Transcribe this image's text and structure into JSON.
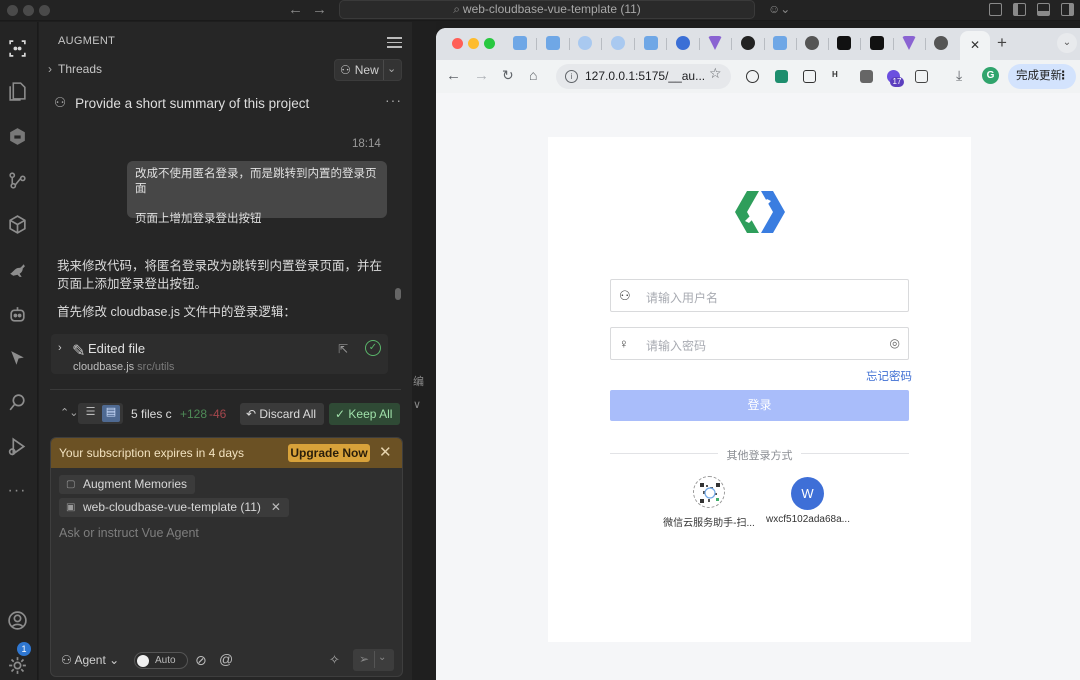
{
  "window": {
    "title": "web-cloudbase-vue-template (11)",
    "back_icon": "arrow-left-icon",
    "forward_icon": "arrow-right-icon",
    "copilot_icon": "copilot-icon"
  },
  "activity_bar": {
    "items": [
      "augment-icon",
      "files-icon",
      "extension-icon",
      "git-icon",
      "package-icon",
      "kangaroo-icon",
      "robot-icon",
      "cursor-icon",
      "search-icon",
      "run-debug-icon",
      "more-icon"
    ],
    "account_badge": "1"
  },
  "augment": {
    "header": "AUGMENT",
    "threads_label": "Threads",
    "new_label": "New",
    "thread_title": "Provide a short summary of this project",
    "more_label": "···",
    "timestamp": "18:14",
    "user_message_lines": [
      "改成不使用匿名登录，而是跳转到内置的登录页面",
      "页面上增加登录登出按钮"
    ],
    "assistant_reply": "我来修改代码，将匿名登录改为跳转到内置登录页面，并在页面上添加登录登出按钮。",
    "assistant_reply2": "首先修改 cloudbase.js 文件中的登录逻辑：",
    "edited_file": {
      "label": "Edited file",
      "filename": "cloudbase.js",
      "path": "src/utils"
    },
    "changes": {
      "files": "5 files c",
      "added": "+128",
      "removed": "-46",
      "discard_label": "Discard All",
      "keep_label": "Keep All"
    },
    "subscription": {
      "text": "Your subscription expires in 4 days",
      "upgrade_label": "Upgrade Now"
    },
    "chips": [
      "Augment Memories",
      "web-cloudbase-vue-template (11)"
    ],
    "placeholder": "Ask or instruct Vue Agent",
    "mode_label": "Agent",
    "auto_label": "Auto"
  },
  "gap_fragments": [
    "编",
    "∨"
  ],
  "browser": {
    "active_tab_close": "✕",
    "address": "127.0.0.1:5175/__au...",
    "update_label": "完成更新",
    "ext_badge": "17",
    "profile_initial": "G"
  },
  "login": {
    "username_placeholder": "请输入用户名",
    "password_placeholder": "请输入密码",
    "forgot_label": "忘记密码",
    "login_label": "登录",
    "other_methods": "其他登录方式",
    "qr_label": "微信云服务助手-扫...",
    "wx_initial": "W",
    "wx_label": "wxcf5102ada68a..."
  }
}
